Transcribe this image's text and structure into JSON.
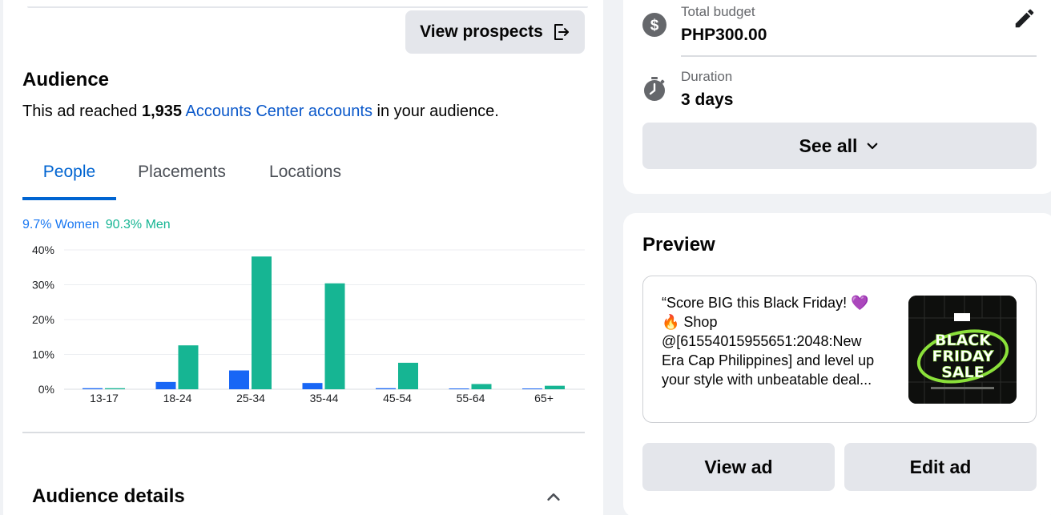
{
  "header": {
    "view_prospects_label": "View prospects",
    "icon": "exit-icon"
  },
  "audience": {
    "title": "Audience",
    "reach_prefix": "This ad reached ",
    "reach_count": "1,935",
    "reach_link": "Accounts Center accounts",
    "reach_suffix": " in your audience."
  },
  "tabs": [
    {
      "label": "People",
      "active": true
    },
    {
      "label": "Placements",
      "active": false
    },
    {
      "label": "Locations",
      "active": false
    }
  ],
  "gender_split": {
    "women": "9.7% Women",
    "men": "90.3% Men"
  },
  "colors": {
    "women": "#1866f5",
    "men": "#16b593",
    "accent": "#0064d1",
    "link": "#0a58ca"
  },
  "chart_data": {
    "type": "bar",
    "categories": [
      "13-17",
      "18-24",
      "25-34",
      "35-44",
      "45-54",
      "55-64",
      "65+"
    ],
    "series": [
      {
        "name": "Women",
        "values": [
          0.3,
          2.1,
          5.4,
          1.8,
          0.3,
          0.1,
          0.1
        ]
      },
      {
        "name": "Men",
        "values": [
          0.3,
          12.6,
          38.1,
          30.4,
          7.6,
          1.5,
          1.0
        ]
      }
    ],
    "yticks": [
      "0%",
      "10%",
      "20%",
      "30%",
      "40%"
    ],
    "ylim": [
      0,
      40
    ],
    "grid": true
  },
  "audience_details": {
    "title": "Audience details",
    "icon": "chevron-up-icon"
  },
  "budget": {
    "total_label": "Total budget",
    "total_value": "PHP300.00",
    "duration_label": "Duration",
    "duration_value": "3 days",
    "see_all_label": "See all",
    "icons": [
      "dollar-circle-icon",
      "stopwatch-icon",
      "pencil-icon",
      "chevron-down-icon"
    ]
  },
  "preview": {
    "title": "Preview",
    "lines": [
      "“Score BIG this Black Friday! 💜",
      "🔥 Shop",
      "@[61554015955651:2048:New",
      "Era Cap Philippines] and level up",
      "your style with unbeatable deal..."
    ],
    "thumb_text": [
      "BLACK",
      "FRIDAY",
      "SALE"
    ],
    "view_ad_label": "View ad",
    "edit_ad_label": "Edit ad"
  }
}
